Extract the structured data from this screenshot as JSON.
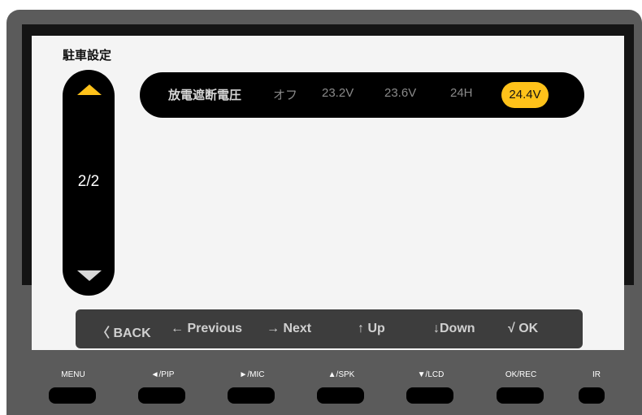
{
  "screen": {
    "title": "駐車設定",
    "page_indicator": "2/2"
  },
  "setting": {
    "label": "放電遮断電圧",
    "options": [
      "オフ",
      "23.2V",
      "23.6V",
      "24H",
      "24.4V"
    ],
    "selected_index": 4
  },
  "nav": {
    "back": "〈 BACK",
    "previous": "← Previous",
    "next": "→  Next",
    "up": "↑ Up",
    "down": "↓Down",
    "ok": "√ OK"
  },
  "hardware_buttons": [
    "MENU",
    "◄/PIP",
    "►/MIC",
    "▲/SPK",
    "▼/LCD",
    "OK/REC",
    "IR"
  ],
  "colors": {
    "accent": "#ffc21a",
    "panel": "#000000",
    "device": "#5b5b5b",
    "screen": "#f4f4f4",
    "nav_bar": "#3d3d3d"
  }
}
